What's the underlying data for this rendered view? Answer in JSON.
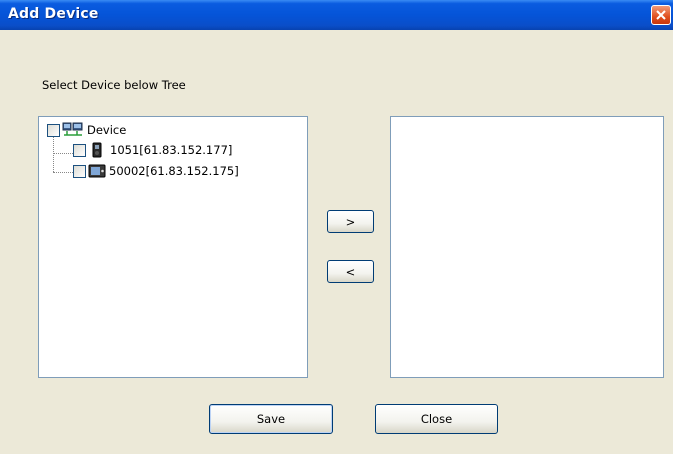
{
  "window": {
    "title": "Add Device"
  },
  "prompt": "Select Device below Tree",
  "tree": {
    "root": {
      "label": "Device",
      "checked": false,
      "icon": "device-group-icon"
    },
    "children": [
      {
        "label": "1051[61.83.152.177]",
        "checked": false,
        "icon": "fingerprint-reader-icon"
      },
      {
        "label": "50002[61.83.152.175]",
        "checked": false,
        "icon": "face-terminal-icon"
      }
    ]
  },
  "selected_devices": [],
  "buttons": {
    "add": ">",
    "remove": "<",
    "save": "Save",
    "close": "Close"
  },
  "colors": {
    "titlebar": "#0554d8",
    "background": "#ece9d8",
    "list_border": "#7f9db9"
  }
}
